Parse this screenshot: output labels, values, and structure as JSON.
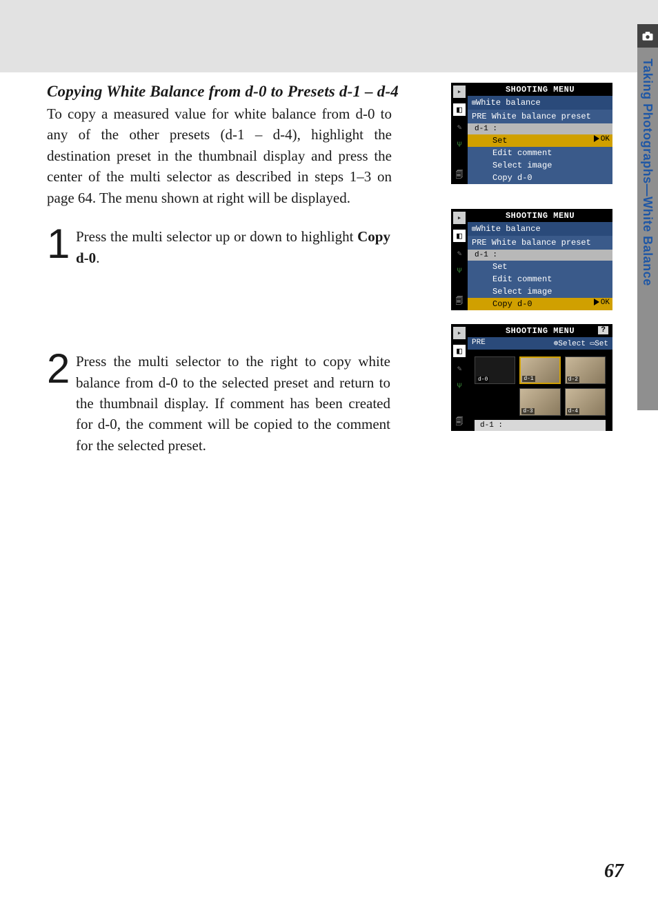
{
  "heading": "Copying White Balance from d-0 to Presets d-1 – d-4",
  "intro": "To copy a measured value for white balance from d-0 to any of the other presets (d-1 – d-4), highlight the destination preset in the thumbnail display and press the center of the multi selector as described in steps 1–3 on page 64.  The menu shown at right will be displayed.",
  "steps": [
    {
      "num": "1",
      "pre": "Press the multi selector up or down to high­light ",
      "bold": "Copy d-0",
      "post": "."
    },
    {
      "num": "2",
      "pre": "Press the multi selector to the right to copy white balance from d-0 to the selected preset and return to the thumbnail display.  If com­ment has been created for d-0, the comment will be copied to the comment for the selected preset.",
      "bold": "",
      "post": ""
    }
  ],
  "lcd_shared": {
    "title": "SHOOTING MENU",
    "h1": "White balance",
    "h2": "PRE  White balance preset",
    "slot": "d-1    :",
    "ok": "OK"
  },
  "lcd1_items": [
    "Set",
    "Edit comment",
    "Select image",
    "Copy d-0"
  ],
  "lcd2_items": [
    "Set",
    "Edit comment",
    "Select image",
    "Copy d-0"
  ],
  "lcd3": {
    "pre": "PRE",
    "select": "Select",
    "set": "Set",
    "thumbs": [
      "d-0",
      "d-1",
      "d-2",
      "d-3",
      "d-4"
    ],
    "foot": "d-1 :"
  },
  "sidetab": "Taking Photographs—White Balance",
  "pagenum": "67"
}
